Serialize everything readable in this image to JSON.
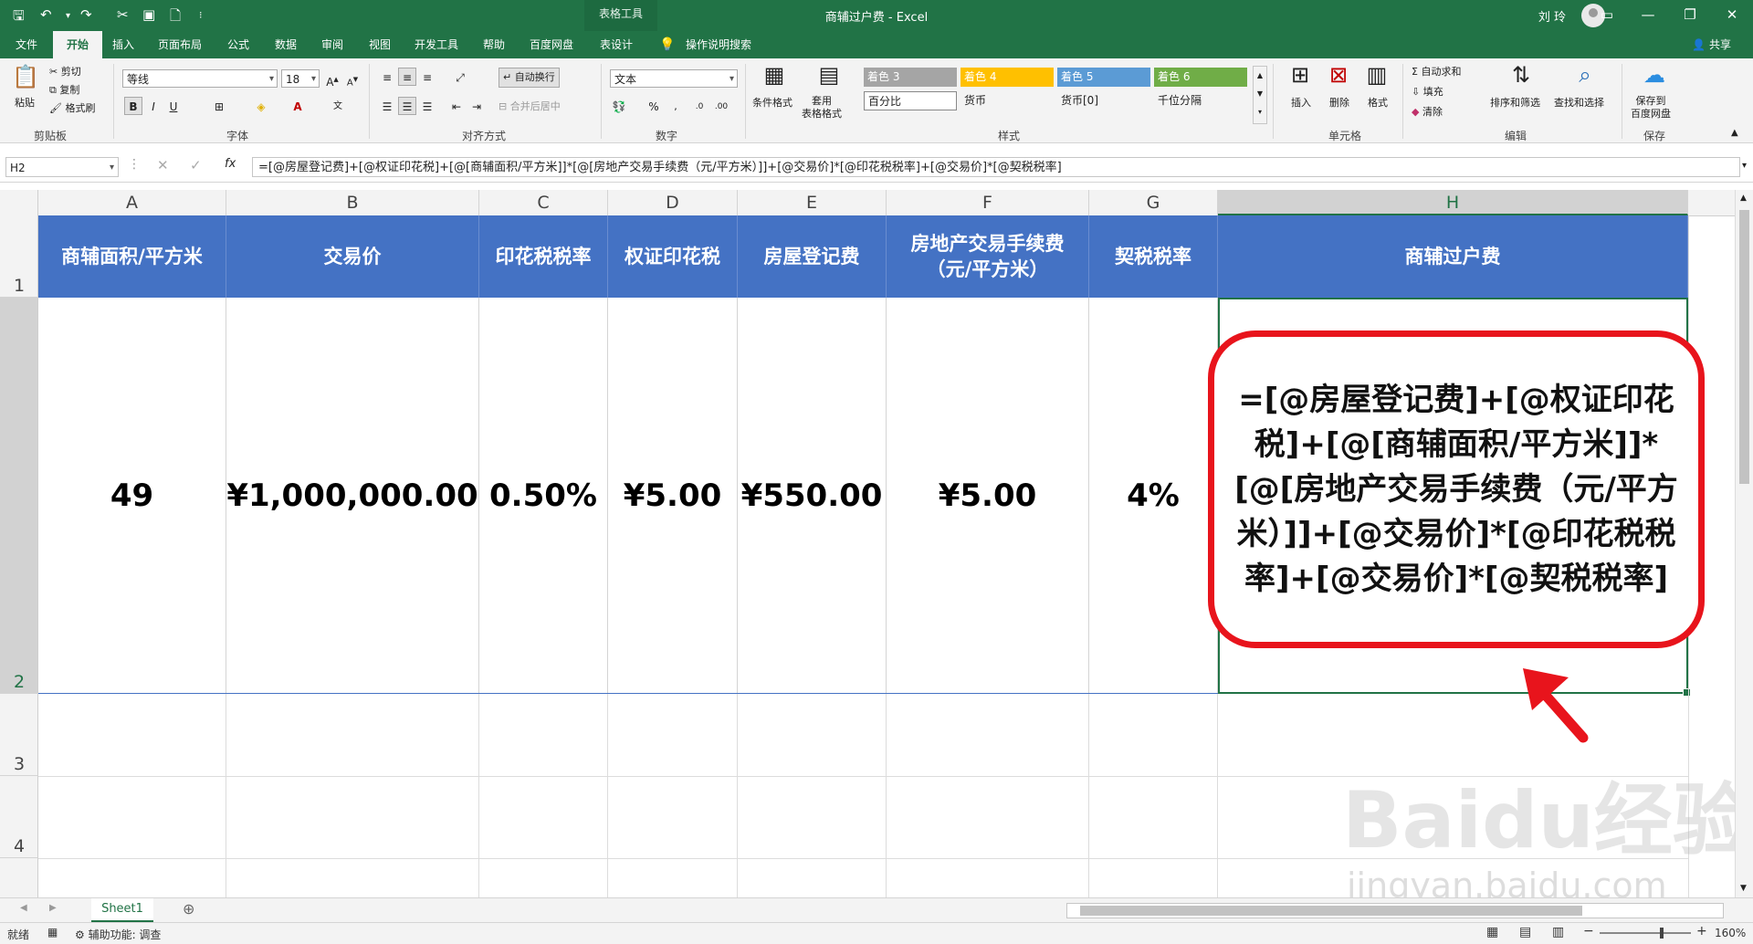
{
  "window": {
    "title": "商辅过户费 - Excel",
    "context_tab": "表格工具",
    "user": "刘 玲",
    "min_icon": "minimize-icon",
    "restore_icon": "restore-icon",
    "close_icon": "close-icon"
  },
  "tabs": [
    "文件",
    "开始",
    "插入",
    "页面布局",
    "公式",
    "数据",
    "审阅",
    "视图",
    "开发工具",
    "帮助",
    "百度网盘",
    "表设计"
  ],
  "active_tab": "开始",
  "tell_me": "操作说明搜索",
  "share": "共享",
  "ribbon": {
    "clipboard": {
      "label": "剪贴板",
      "paste": "粘贴",
      "cut": "剪切",
      "copy": "复制",
      "format_painter": "格式刷"
    },
    "font": {
      "label": "字体",
      "name": "等线",
      "size": "18",
      "bold": "B",
      "italic": "I",
      "underline": "U"
    },
    "alignment": {
      "label": "对齐方式",
      "wrap": "自动换行",
      "merge": "合并后居中"
    },
    "number": {
      "label": "数字",
      "format": "文本",
      "percent": "%"
    },
    "styles": {
      "label": "样式",
      "conditional": "条件格式",
      "table_format": "套用\n表格格式",
      "swatches": [
        {
          "text": "着色 3",
          "color": "#a5a5a5"
        },
        {
          "text": "着色 4",
          "color": "#ffc000"
        },
        {
          "text": "着色 5",
          "color": "#5b9bd5"
        },
        {
          "text": "着色 6",
          "color": "#70ad47"
        }
      ],
      "row2": [
        "百分比",
        "货币",
        "货币[0]",
        "千位分隔"
      ]
    },
    "cells": {
      "label": "单元格",
      "insert": "插入",
      "delete": "删除",
      "format": "格式"
    },
    "editing": {
      "label": "编辑",
      "autosum": "自动求和",
      "fill": "填充",
      "clear": "清除",
      "sort": "排序和筛选",
      "find": "查找和选择"
    },
    "save": {
      "label": "保存",
      "btn": "保存到\n百度网盘"
    }
  },
  "formula_bar": {
    "name_box": "H2",
    "fx": "fx",
    "formula": "=[@房屋登记费]+[@权证印花税]+[@[商辅面积/平方米]]*[@[房地产交易手续费（元/平方米）]]+[@交易价]*[@印花税税率]+[@交易价]*[@契税税率]"
  },
  "columns": [
    "A",
    "B",
    "C",
    "D",
    "E",
    "F",
    "G",
    "H"
  ],
  "rows": [
    "1",
    "2",
    "3",
    "4"
  ],
  "table": {
    "headers": [
      "商辅面积/平方米",
      "交易价",
      "印花税税率",
      "权证印花税",
      "房屋登记费",
      "房地产交易手续费\n（元/平方米）",
      "契税税率",
      "商辅过户费"
    ],
    "row2": [
      "49",
      "¥1,000,000.00",
      "0.50%",
      "¥5.00",
      "¥550.00",
      "¥5.00",
      "4%"
    ],
    "h2_formula_display": "=[@房屋登记费]+[@权证印花税]+[@[商辅面积/平方米]]*[@[房地产交易手续费（元/平方米）]]+[@交易价]*[@印花税税率]+[@交易价]*[@契税税率]"
  },
  "sheets": [
    "Sheet1"
  ],
  "status": {
    "ready": "就绪",
    "accessibility": "辅助功能: 调查",
    "zoom": "160%"
  },
  "watermark": {
    "brand": "Baidu经验",
    "url": "jingyan.baidu.com"
  },
  "colors": {
    "excel_green": "#217346",
    "table_header": "#4472c4",
    "callout_red": "#e8141c"
  }
}
